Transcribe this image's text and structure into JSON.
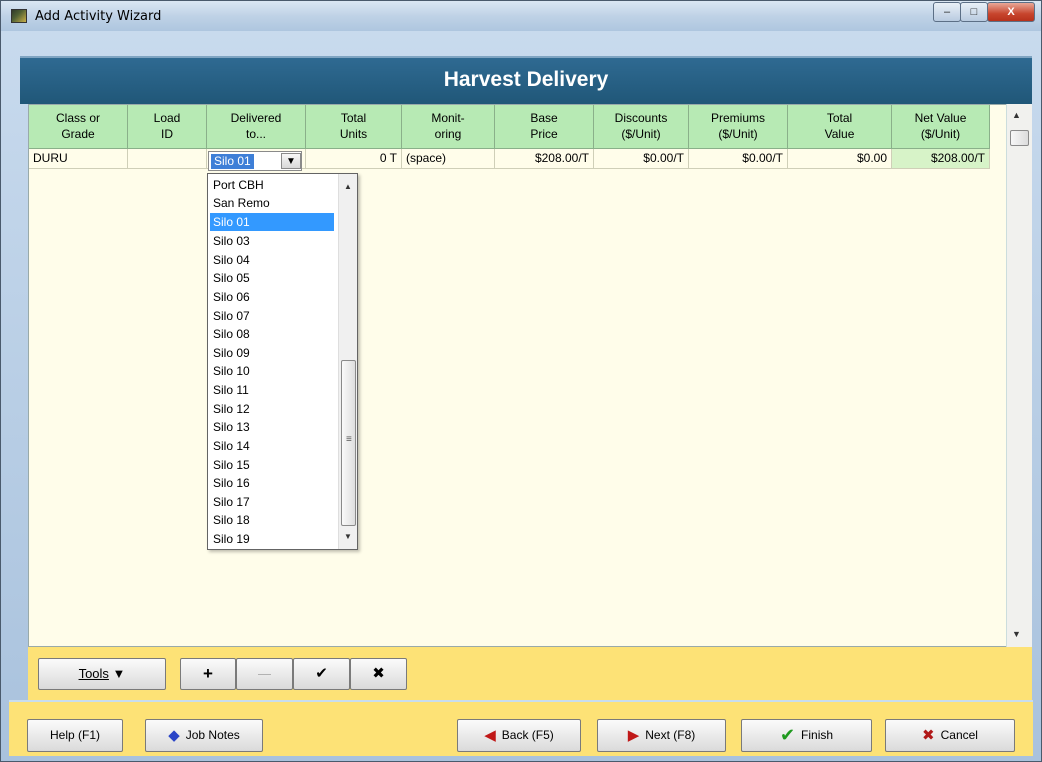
{
  "window": {
    "title": "Add Activity Wizard",
    "min_glyph": "–",
    "max_glyph": "□",
    "close_glyph": "X"
  },
  "header": {
    "title": "Harvest Delivery"
  },
  "columns": [
    {
      "l1": "Class or",
      "l2": "Grade"
    },
    {
      "l1": "Load",
      "l2": "ID"
    },
    {
      "l1": "Delivered",
      "l2": "to..."
    },
    {
      "l1": "Total",
      "l2": "Units"
    },
    {
      "l1": "Monit-",
      "l2": "oring"
    },
    {
      "l1": "Base",
      "l2": "Price"
    },
    {
      "l1": "Discounts",
      "l2": "($/Unit)"
    },
    {
      "l1": "Premiums",
      "l2": "($/Unit)"
    },
    {
      "l1": "Total",
      "l2": "Value"
    },
    {
      "l1": "Net Value",
      "l2": "($/Unit)"
    }
  ],
  "row": {
    "class_grade": "DURU",
    "load_id": "",
    "delivered_to": "Silo 01",
    "total_units": "0 T",
    "monitoring": "(space)",
    "base_price": "$208.00/T",
    "discounts": "$0.00/T",
    "premiums": "$0.00/T",
    "total_value": "$0.00",
    "net_value": "$208.00/T"
  },
  "dropdown": {
    "items": [
      "Port CBH",
      "San Remo",
      "Silo 01",
      "Silo 03",
      "Silo 04",
      "Silo 05",
      "Silo 06",
      "Silo 07",
      "Silo 08",
      "Silo 09",
      "Silo 10",
      "Silo 11",
      "Silo 12",
      "Silo 13",
      "Silo 14",
      "Silo 15",
      "Silo 16",
      "Silo 17",
      "Silo 18",
      "Silo 19"
    ],
    "selected": "Silo 01"
  },
  "toolbar": {
    "tools": "Tools",
    "add": "+",
    "remove": "—",
    "confirm": "✔",
    "cancel": "✖"
  },
  "footer": {
    "help": "Help (F1)",
    "job_notes": "Job Notes",
    "back": "Back (F5)",
    "next": "Next (F8)",
    "finish": "Finish",
    "cancel": "Cancel"
  },
  "colors": {
    "header_band": "#205778",
    "grid_header": "#b7eab4",
    "grid_bg": "#fffdea",
    "toolbar_bg": "#fde276",
    "selection": "#3399ff"
  }
}
